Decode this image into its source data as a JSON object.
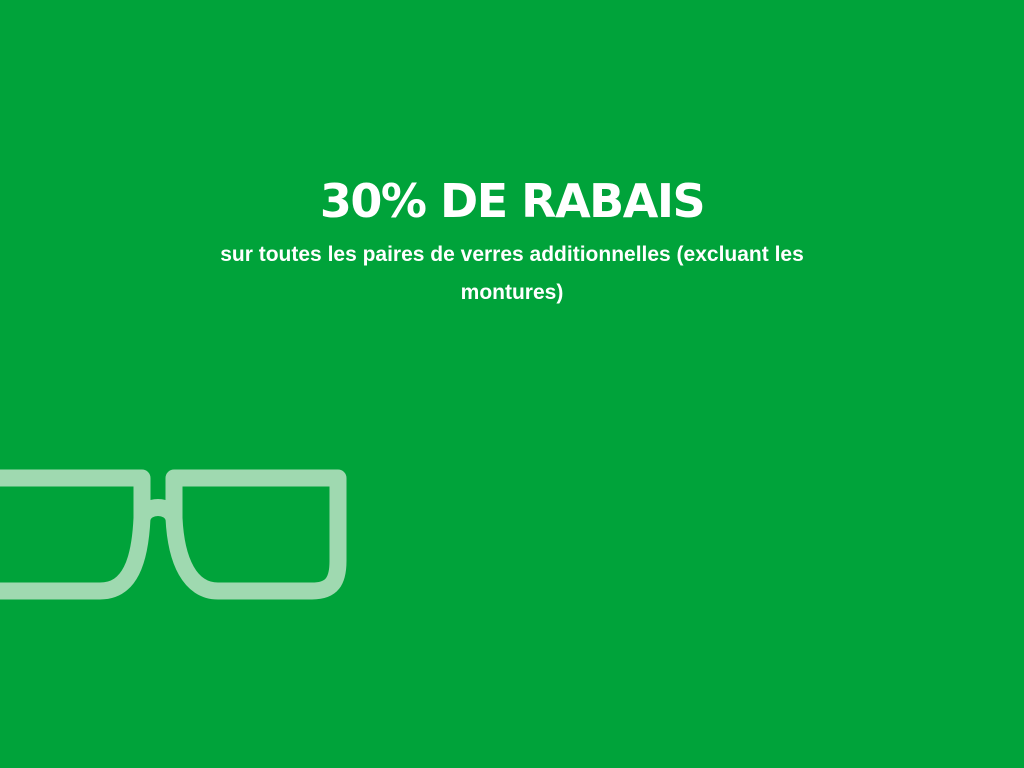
{
  "colors": {
    "background": "#00a33a",
    "text": "#ffffff",
    "icon": "#9fd9b0"
  },
  "promo": {
    "headline": "30% DE RABAIS",
    "subline": "sur toutes les paires de verres additionnelles (excluant les montures)"
  },
  "icons": {
    "decoration": "eyeglasses-icon"
  }
}
